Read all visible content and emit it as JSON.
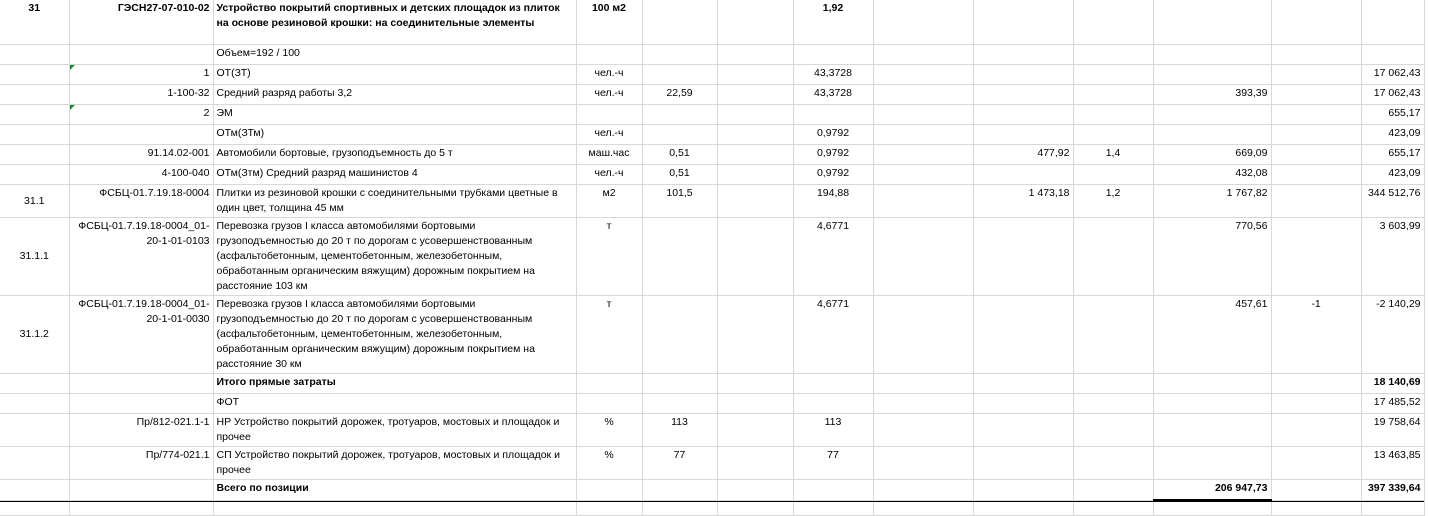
{
  "rows": [
    {
      "c": [
        "31",
        "ГЭСН27-07-010-02",
        "Устройство покрытий спортивных и детских площадок из плиток на основе резиновой крошки: на соединительные элементы",
        "100 м2",
        "",
        "",
        "1,92",
        "",
        "",
        "",
        "",
        "",
        ""
      ],
      "bold": true
    },
    {
      "c": [
        "",
        "",
        "Объем=192 / 100",
        "",
        "",
        "",
        "",
        "",
        "",
        "",
        "",
        "",
        ""
      ]
    },
    {
      "c": [
        "",
        "1",
        "ОТ(ЗТ)",
        "чел.-ч",
        "",
        "",
        "43,3728",
        "",
        "",
        "",
        "",
        "",
        "17 062,43"
      ],
      "tri": true
    },
    {
      "c": [
        "",
        "1-100-32",
        "Средний разряд работы 3,2",
        "чел.-ч",
        "22,59",
        "",
        "43,3728",
        "",
        "",
        "",
        "393,39",
        "",
        "17 062,43"
      ]
    },
    {
      "c": [
        "",
        "2",
        "ЭМ",
        "",
        "",
        "",
        "",
        "",
        "",
        "",
        "",
        "",
        "655,17"
      ],
      "tri": true
    },
    {
      "c": [
        "",
        "",
        "ОТм(ЗТм)",
        "чел.-ч",
        "",
        "",
        "0,9792",
        "",
        "",
        "",
        "",
        "",
        "423,09"
      ]
    },
    {
      "c": [
        "",
        "91.14.02-001",
        "Автомобили бортовые, грузоподъемность до 5 т",
        "маш.час",
        "0,51",
        "",
        "0,9792",
        "",
        "477,92",
        "1,4",
        "669,09",
        "",
        "655,17"
      ]
    },
    {
      "c": [
        "",
        "4-100-040",
        "ОТм(Зтм) Средний разряд машинистов 4",
        "чел.-ч",
        "0,51",
        "",
        "0,9792",
        "",
        "",
        "",
        "432,08",
        "",
        "423,09"
      ]
    },
    {
      "c": [
        "31.1",
        "ФСБЦ-01.7.19.18-0004",
        "Плитки из резиновой крошки с соединительными трубками цветные в один цвет, толщина 45 мм",
        "м2",
        "101,5",
        "",
        "194,88",
        "",
        "1 473,18",
        "1,2",
        "1 767,82",
        "",
        "344 512,76"
      ]
    },
    {
      "c": [
        "31.1.1",
        "ФСБЦ-01.7.19.18-0004_01-20-1-01-0103",
        "Перевозка грузов I класса автомобилями бортовыми грузоподъемностью до 20 т по дорогам с усовершенствованным (асфальтобетонным, цементобетонным, железобетонным, обработанным органическим вяжущим) дорожным покрытием на расстояние 103 км",
        "т",
        "",
        "",
        "4,6771",
        "",
        "",
        "",
        "770,56",
        "",
        "3 603,99"
      ]
    },
    {
      "c": [
        "31.1.2",
        "ФСБЦ-01.7.19.18-0004_01-20-1-01-0030",
        "Перевозка грузов I класса автомобилями бортовыми грузоподъемностью до 20 т по дорогам с усовершенствованным (асфальтобетонным, цементобетонным, железобетонным, обработанным органическим вяжущим) дорожным покрытием на расстояние 30 км",
        "т",
        "",
        "",
        "4,6771",
        "",
        "",
        "",
        "457,61",
        "-1",
        "-2 140,29"
      ]
    },
    {
      "c": [
        "",
        "",
        "Итого прямые затраты",
        "",
        "",
        "",
        "",
        "",
        "",
        "",
        "",
        "",
        "18 140,69"
      ],
      "bold": true,
      "thick": true
    },
    {
      "c": [
        "",
        "",
        "ФОТ",
        "",
        "",
        "",
        "",
        "",
        "",
        "",
        "",
        "",
        "17 485,52"
      ]
    },
    {
      "c": [
        "",
        "Пр/812-021.1-1",
        "НР Устройство покрытий дорожек, тротуаров, мостовых и площадок и прочее",
        "%",
        "113",
        "",
        "113",
        "",
        "",
        "",
        "",
        "",
        "19 758,64"
      ]
    },
    {
      "c": [
        "",
        "Пр/774-021.1",
        "СП Устройство покрытий дорожек, тротуаров, мостовых и площадок и прочее",
        "%",
        "77",
        "",
        "77",
        "",
        "",
        "",
        "",
        "",
        "13 463,85"
      ]
    },
    {
      "c": [
        "",
        "",
        "Всего по позиции",
        "",
        "",
        "",
        "",
        "",
        "",
        "",
        "206 947,73",
        "",
        "397 339,64"
      ],
      "bold": true,
      "thick": true
    },
    {
      "c": [
        "",
        "",
        "",
        "",
        "",
        "",
        "",
        "",
        "",
        "",
        "",
        "",
        ""
      ]
    }
  ]
}
